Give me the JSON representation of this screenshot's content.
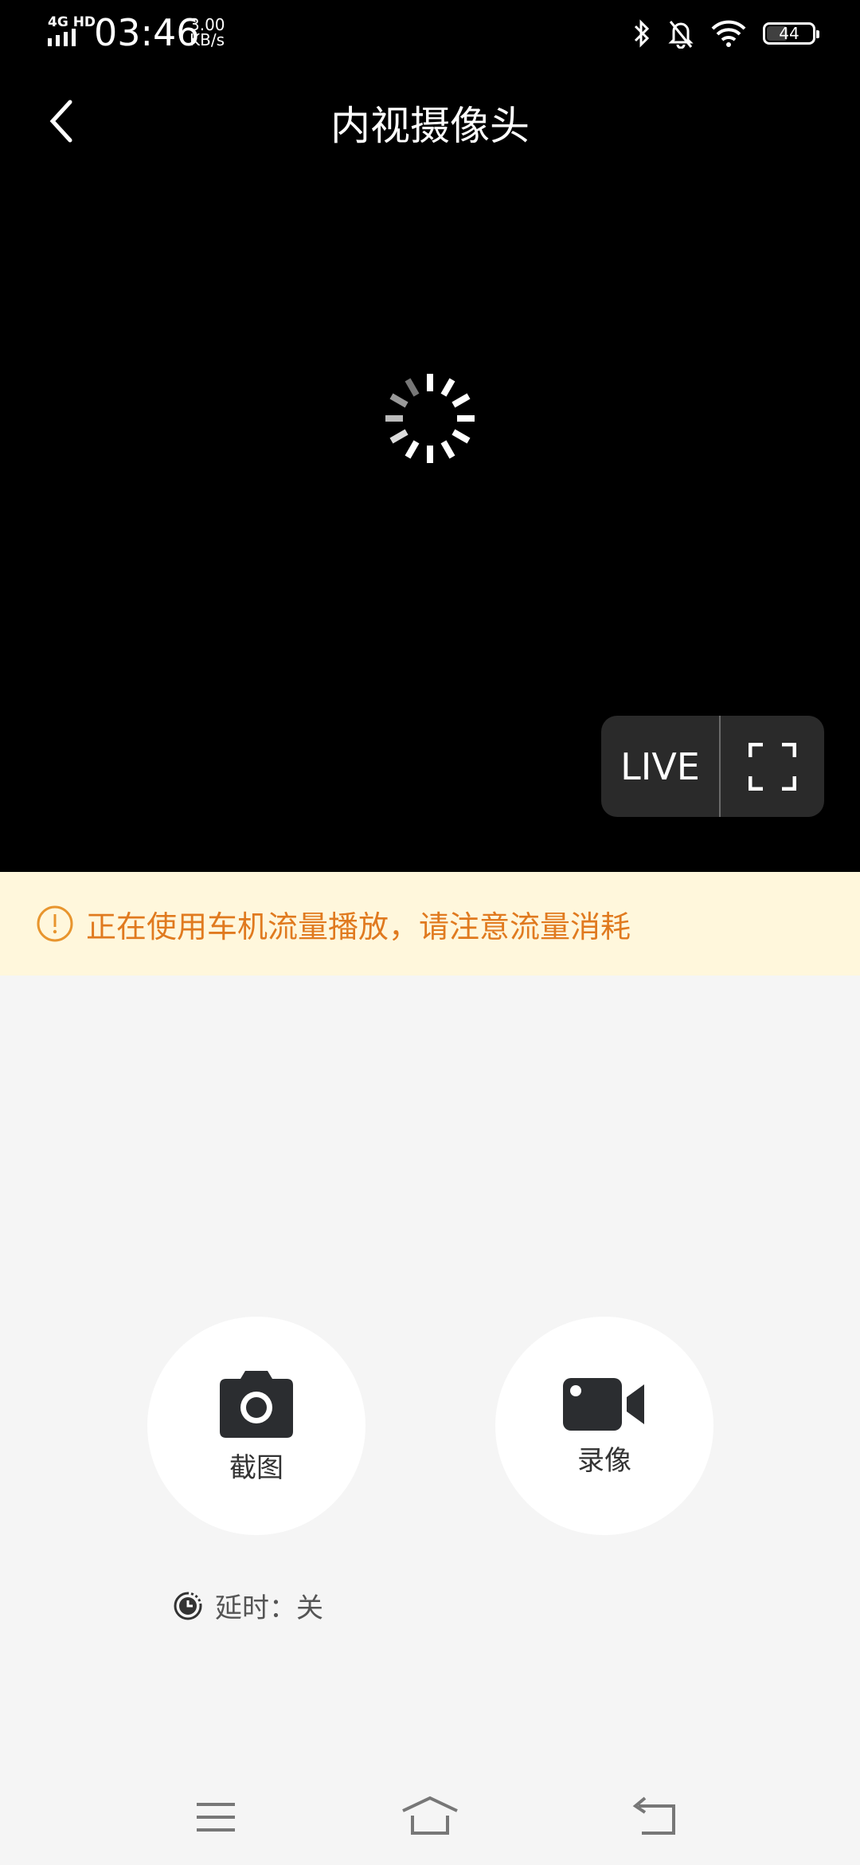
{
  "status_bar": {
    "network": "4G HD",
    "time": "03:46",
    "speed_value": "3.00",
    "speed_unit": "KB/s",
    "battery": "44"
  },
  "header": {
    "title": "内视摄像头"
  },
  "player": {
    "state": "loading",
    "live_label": "LIVE"
  },
  "warning": {
    "text": "正在使用车机流量播放，请注意流量消耗",
    "color": "#e07a1f",
    "background": "#fff7dc"
  },
  "actions": {
    "screenshot_label": "截图",
    "record_label": "录像"
  },
  "delay": {
    "label": "延时：关"
  },
  "nav": {
    "icons": [
      "menu-icon",
      "home-icon",
      "back-icon"
    ]
  }
}
